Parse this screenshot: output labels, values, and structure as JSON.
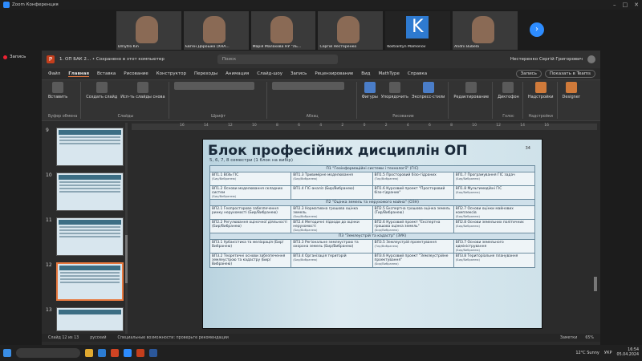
{
  "zoom": {
    "title": "Zoom Конференция",
    "recording": "Запись"
  },
  "participants": [
    {
      "name": "Dmytro Kin"
    },
    {
      "name": "Євген Дорошко (ХНА..."
    },
    {
      "name": "Марія Малахова НУ \"Ль..."
    },
    {
      "name": "Сергій Нестеренко"
    },
    {
      "name": "Kostiantyn Mamonov",
      "initial": "K"
    },
    {
      "name": "Andrii Bubela"
    }
  ],
  "ppt": {
    "doc_title": "1. ОП БАК 2... • Сохранено в этот компьютер",
    "search": "Поиск",
    "user": "Нестеренко Сергій Григорович",
    "menu": [
      "Файл",
      "Главная",
      "Вставка",
      "Рисование",
      "Конструктор",
      "Переходы",
      "Анимация",
      "Слайд-шоу",
      "Запись",
      "Рецензирование",
      "Вид",
      "MathType",
      "Справка"
    ],
    "record_btn": "Запись",
    "teams_btn": "Показать в Teams",
    "ribbon": {
      "paste": "Вставить",
      "clipboard": "Буфер обмена",
      "new_slide": "Создать слайд",
      "reuse": "Исп-ть слайды снова",
      "slides": "Слайды",
      "font": "Шрифт",
      "paragraph": "Абзац",
      "shapes": "Фигуры",
      "arrange": "Упорядочить",
      "quick_styles": "Экспресс-стили",
      "drawing": "Рисование",
      "editing": "Редактирование",
      "dictation": "Диктофон",
      "voice": "Голос",
      "addins": "Надстройки",
      "addins_group": "Надстройки",
      "designer": "Designer"
    },
    "thumb_numbers": [
      "9",
      "10",
      "11",
      "12",
      "13"
    ],
    "ruler": [
      "16",
      "14",
      "12",
      "10",
      "8",
      "6",
      "4",
      "2",
      "0",
      "2",
      "4",
      "6",
      "8",
      "10",
      "12",
      "14",
      "16"
    ],
    "status": {
      "slide": "Слайд 12 из 13",
      "lang": "русский",
      "accessibility": "Специальные возможности: проверьте рекомендации",
      "notes": "Заметки",
      "zoom": "65%"
    }
  },
  "slide": {
    "title": "Блок професійних дисциплін ОП",
    "subtitle": "5, 6, 7, 8 семестри (1 блок на вибір)",
    "number": "34",
    "blocks": [
      {
        "header": "П1 \"Геоінформаційні системи і технології\" (ГІС)",
        "rows": [
          [
            {
              "t": "ВП1.1 ВІЗЬ ГІС",
              "m": "(Бир/Вибранею)"
            },
            {
              "t": "ВП1.3 Тривимірне моделювання",
              "m": "(Бир/Вибранею)"
            },
            {
              "t": "ВП1.5 Просторовий бізо-гідраних",
              "m": "(Тир/Вибранею)"
            },
            {
              "t": "ВП1.7 Програмування ГІС задач",
              "m": "(Бир/Вибранею)"
            }
          ],
          [
            {
              "t": "ВП1.2 Основи моделювання складних систем",
              "m": "(Бир/Вибранею)"
            },
            {
              "t": "ВП1.4 ГІС-аналіз (Бир/Вибранею)",
              "m": ""
            },
            {
              "t": "ВП1.6 Курсовий проект \"Просторовий бізо-гідраних\"",
              "m": ""
            },
            {
              "t": "ВП1.8 Мультимедійні ГІС",
              "m": "(Бир/Вибранею)"
            }
          ]
        ]
      },
      {
        "header": "П2 \"Оцінка земель та нерухомого майна\" (ОЗН)",
        "rows": [
          [
            {
              "t": "ВП2.1 Геопросторове забезпечення ринку нерухомості (Бир/Вибранею)",
              "m": ""
            },
            {
              "t": "ВП2.3 Нормативна грошова оцінка земель",
              "m": "(Бир/Вибранею)"
            },
            {
              "t": "ВП2.5 Експертна грошова оцінка земель (Тир/Вибранею)",
              "m": ""
            },
            {
              "t": "ВП2.7 Основи оцінки майнових комплексів",
              "m": "(Бир/Вибранею)"
            }
          ],
          [
            {
              "t": "ВП2.2 Регулювання оціночної діяльності (Бир/Вибранею)",
              "m": ""
            },
            {
              "t": "ВП2.4 Методичні підходи до оцінки нерухомості",
              "m": "(Бир/Вибранею)"
            },
            {
              "t": "ВП2.6 Курсовий проект \"Експертна грошова оцінка земель\"",
              "m": "(Бир/Вибранею)"
            },
            {
              "t": "ВП2.8 Основи земельних політичних",
              "m": "(Бир/Вибранею)"
            }
          ]
        ]
      },
      {
        "header": "П3 \"Землеустрій та кадастр\" (ЗУК)",
        "rows": [
          [
            {
              "t": "ВП3.1 Урбаністика та меліорація (Бир/Вибранею)",
              "m": ""
            },
            {
              "t": "ВП3.3 Регіональне землеустрою та охорона земель (Бир/Вибранею)",
              "m": ""
            },
            {
              "t": "ВП3.5 Землеустрій проектування",
              "m": "(Тир/Вибранею)"
            },
            {
              "t": "ВП3.7 Основи земельного адміністрування",
              "m": "(Бир/Вибранею)"
            }
          ],
          [
            {
              "t": "ВП3.2 Теоретичні основи забезпечення землеустрою та кадастру (Бир/Вибранею)",
              "m": ""
            },
            {
              "t": "ВП3.4 Організація територій",
              "m": "(Бир/Вибранею)"
            },
            {
              "t": "ВП3.6 Курсовий проект \"Землеустрійне проектування\"",
              "m": "(Бир/Вибранею)"
            },
            {
              "t": "ВП3.8 Територіальне планування",
              "m": "(Бир/Вибранею)"
            }
          ]
        ]
      }
    ]
  },
  "taskbar": {
    "weather": "12°C Sunny",
    "lang": "УКР",
    "time": "16:54",
    "date": "05.04.2024"
  }
}
